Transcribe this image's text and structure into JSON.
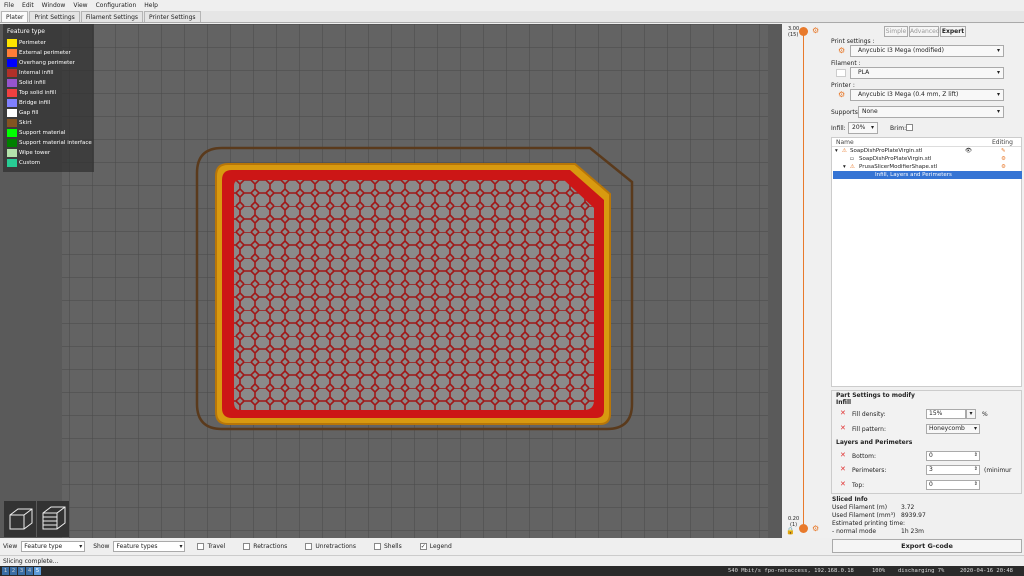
{
  "menu": [
    "File",
    "Edit",
    "Window",
    "View",
    "Configuration",
    "Help"
  ],
  "tabs": [
    "Plater",
    "Print Settings",
    "Filament Settings",
    "Printer Settings"
  ],
  "legend": {
    "title": "Feature type",
    "items": [
      {
        "label": "Perimeter",
        "color": "#ffe400"
      },
      {
        "label": "External perimeter",
        "color": "#ff7d38"
      },
      {
        "label": "Overhang perimeter",
        "color": "#0000ff"
      },
      {
        "label": "Internal infill",
        "color": "#b03029"
      },
      {
        "label": "Solid infill",
        "color": "#9654cc"
      },
      {
        "label": "Top solid infill",
        "color": "#f04040"
      },
      {
        "label": "Bridge infill",
        "color": "#8080ff"
      },
      {
        "label": "Gap fill",
        "color": "#ffffff"
      },
      {
        "label": "Skirt",
        "color": "#845321"
      },
      {
        "label": "Support material",
        "color": "#00ff00"
      },
      {
        "label": "Support material interface",
        "color": "#008000"
      },
      {
        "label": "Wipe tower",
        "color": "#b3e3ab"
      },
      {
        "label": "Custom",
        "color": "#28cc94"
      }
    ]
  },
  "slider": {
    "top_value": "3.00",
    "top_layer": "(15)",
    "bottom_value": "0.20",
    "bottom_layer": "(1)"
  },
  "mode": {
    "simple": "Simple",
    "advanced": "Advanced",
    "expert": "Expert"
  },
  "print_settings": {
    "label": "Print settings :",
    "value": "Anycubic I3 Mega (modified)"
  },
  "filament": {
    "label": "Filament :",
    "value": "PLA",
    "swatch": "#ffffff"
  },
  "printer": {
    "label": "Printer :",
    "value": "Anycubic I3 Mega (0.4 mm, Z lift)"
  },
  "supports": {
    "label": "Supports:",
    "value": "None"
  },
  "infill": {
    "label": "Infill:",
    "value": "20%"
  },
  "brim": {
    "label": "Brim:"
  },
  "tree": {
    "col_name": "Name",
    "col_editing": "Editing",
    "rows": [
      {
        "label": "SoapDishProPlateVirgin.stl"
      },
      {
        "label": "SoapDishProPlateVirgin.stl"
      },
      {
        "label": "PrusaSlicerModifierShape.stl"
      },
      {
        "label": "Infill, Layers and Perimeters"
      }
    ]
  },
  "part_settings": {
    "title": "Part Settings to modify",
    "infill_header": "Infill",
    "fill_density_label": "Fill density:",
    "fill_density": "15%",
    "pct": "%",
    "fill_pattern_label": "Fill pattern:",
    "fill_pattern": "Honeycomb",
    "layers_header": "Layers and Perimeters",
    "bottom_label": "Bottom:",
    "bottom": "0",
    "perimeters_label": "Perimeters:",
    "perimeters": "3",
    "minimum": "(minimur",
    "top_label": "Top:",
    "top": "0"
  },
  "sliced": {
    "title": "Sliced Info",
    "used_m_label": "Used Filament (m)",
    "used_m": "3.72",
    "used_mm3_label": "Used Filament (mm³)",
    "used_mm3": "8939.97",
    "time_label": "Estimated printing time:",
    "mode_label": "- normal mode",
    "time": "1h 23m"
  },
  "export_label": "Export G-code",
  "bottom": {
    "view_label": "View",
    "view_value": "Feature type",
    "show_label": "Show",
    "show_value": "Feature types",
    "travel": "Travel",
    "retractions": "Retractions",
    "unretractions": "Unretractions",
    "shells": "Shells",
    "legend": "Legend"
  },
  "status": "Slicing complete...",
  "taskbar": {
    "workspaces": [
      "1",
      "2",
      "3",
      "4",
      "5"
    ],
    "net": "540 Mbit/s fpo-netaccess, 192.168.0.18",
    "vol": "100%",
    "bat": "discharging 7%",
    "clock": "2020-04-16 20:48"
  }
}
